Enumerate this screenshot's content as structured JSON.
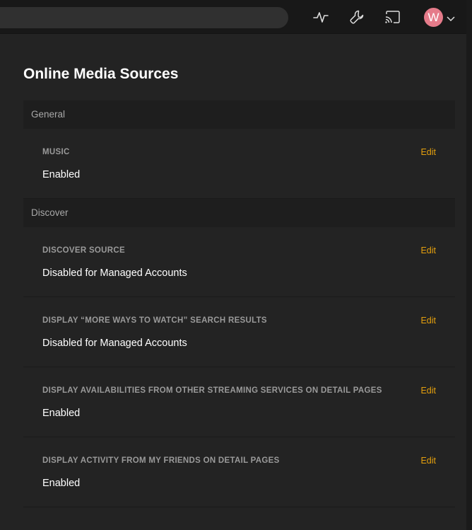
{
  "page": {
    "title": "Online Media Sources"
  },
  "toolbar": {
    "icons": [
      "activity-icon",
      "wrench-icon",
      "cast-icon"
    ],
    "avatar_initial": "W"
  },
  "sections": [
    {
      "header": "General",
      "settings": [
        {
          "label": "MUSIC",
          "value": "Enabled",
          "edit_label": "Edit"
        }
      ]
    },
    {
      "header": "Discover",
      "settings": [
        {
          "label": "DISCOVER SOURCE",
          "value": "Disabled for Managed Accounts",
          "edit_label": "Edit"
        },
        {
          "label": "DISPLAY “MORE WAYS TO WATCH” SEARCH RESULTS",
          "value": "Disabled for Managed Accounts",
          "edit_label": "Edit"
        },
        {
          "label": "DISPLAY AVAILABILITIES FROM OTHER STREAMING SERVICES ON DETAIL PAGES",
          "value": "Enabled",
          "edit_label": "Edit"
        },
        {
          "label": "DISPLAY ACTIVITY FROM MY FRIENDS ON DETAIL PAGES",
          "value": "Enabled",
          "edit_label": "Edit"
        }
      ]
    }
  ],
  "colors": {
    "background": "#232323",
    "accent": "#e5a00d",
    "avatar": "#e57b8a"
  }
}
